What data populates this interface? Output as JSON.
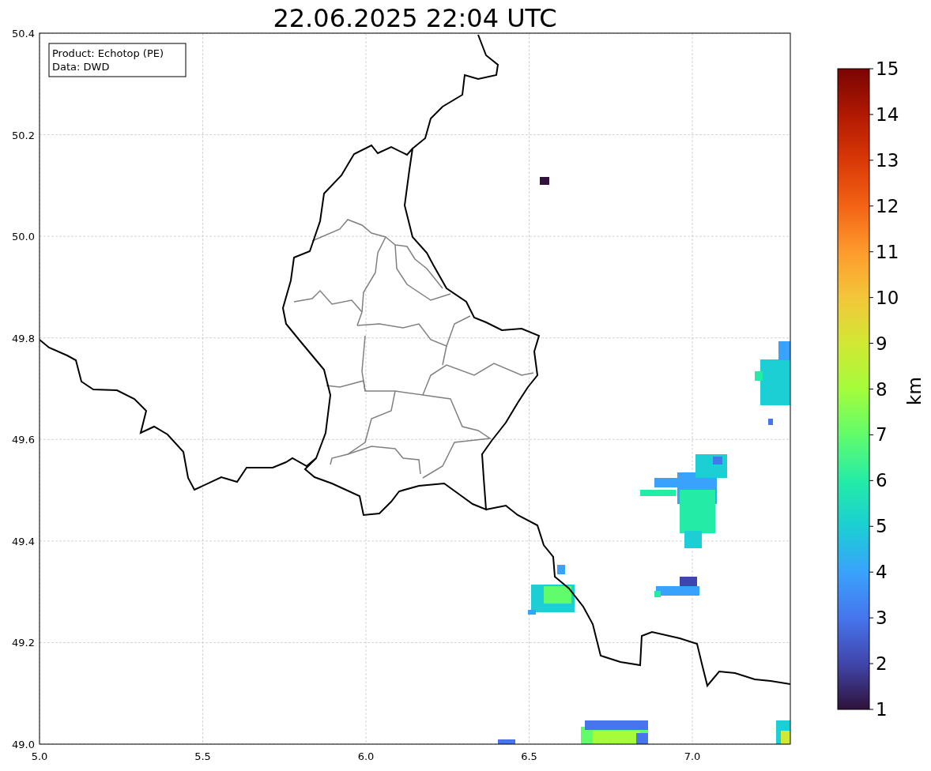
{
  "title": "22.06.2025 22:04 UTC",
  "info_box": [
    "Product: Echotop (PE)",
    "Data: DWD"
  ],
  "x_ticks": [
    "5.0",
    "5.5",
    "6.0",
    "6.5",
    "7.0"
  ],
  "y_ticks": [
    "50.4",
    "50.2",
    "50.0",
    "49.8",
    "49.6",
    "49.4",
    "49.2",
    "49.0"
  ],
  "colorbar": {
    "label": "km",
    "ticks": [
      "15",
      "14",
      "13",
      "12",
      "11",
      "10",
      "9",
      "8",
      "7",
      "6",
      "5",
      "4",
      "3",
      "2",
      "1"
    ]
  }
}
